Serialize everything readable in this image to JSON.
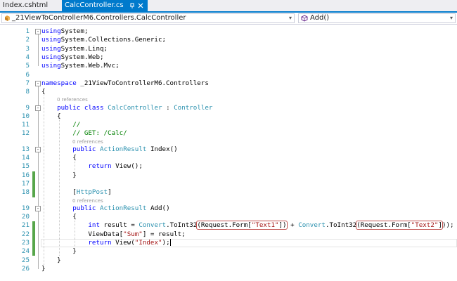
{
  "tabs": [
    {
      "label": "Index.cshtml",
      "active": false
    },
    {
      "label": "CalcController.cs",
      "active": true,
      "pin_icon": "pin-icon",
      "close_icon": "close-icon"
    }
  ],
  "navbar": {
    "type_selector": "_21ViewToControllerM6.Controllers.CalcController",
    "member_selector": "Add()",
    "type_icon": "class-icon",
    "member_icon": "method-icon"
  },
  "codelens": "0 references",
  "colors": {
    "keyword": "#0000ff",
    "type": "#2b91af",
    "comment": "#008000",
    "string": "#a31515",
    "line_number": "#2b91af",
    "accent": "#007acc",
    "highlight_box": "#c0504d",
    "change_bar": "#57a64a"
  },
  "lines": [
    {
      "n": "1",
      "tokens": [
        [
          "kw",
          "using"
        ],
        [
          "",
          "System;"
        ]
      ]
    },
    {
      "n": "2",
      "tokens": [
        [
          "kw",
          "using"
        ],
        [
          "",
          "System.Collections.Generic;"
        ]
      ]
    },
    {
      "n": "3",
      "tokens": [
        [
          "kw",
          "using"
        ],
        [
          "",
          "System.Linq;"
        ]
      ]
    },
    {
      "n": "4",
      "tokens": [
        [
          "kw",
          "using"
        ],
        [
          "",
          "System.Web;"
        ]
      ]
    },
    {
      "n": "5",
      "tokens": [
        [
          "kw",
          "using"
        ],
        [
          "",
          "System.Web.Mvc;"
        ]
      ]
    },
    {
      "n": "6",
      "tokens": []
    },
    {
      "n": "7",
      "tokens": [
        [
          "kw",
          "namespace"
        ],
        [
          "",
          " _21ViewToControllerM6.Controllers"
        ]
      ]
    },
    {
      "n": "8",
      "tokens": [
        [
          "",
          "{"
        ]
      ]
    },
    {
      "n": "9",
      "lens": true,
      "tokens": [
        [
          "",
          "    "
        ],
        [
          "kw",
          "public class"
        ],
        [
          "",
          " "
        ],
        [
          "ty",
          "CalcController"
        ],
        [
          "",
          " : "
        ],
        [
          "ty",
          "Controller"
        ]
      ]
    },
    {
      "n": "10",
      "tokens": [
        [
          "",
          "    {"
        ]
      ]
    },
    {
      "n": "11",
      "tokens": [
        [
          "",
          "        "
        ],
        [
          "cm",
          "//"
        ]
      ]
    },
    {
      "n": "12",
      "tokens": [
        [
          "",
          "        "
        ],
        [
          "cm",
          "// GET: /Calc/"
        ]
      ]
    },
    {
      "n": "13",
      "lens": true,
      "tokens": [
        [
          "",
          "        "
        ],
        [
          "kw",
          "public"
        ],
        [
          "",
          " "
        ],
        [
          "ty",
          "ActionResult"
        ],
        [
          "",
          " Index()"
        ]
      ]
    },
    {
      "n": "14",
      "tokens": [
        [
          "",
          "        {"
        ]
      ]
    },
    {
      "n": "15",
      "tokens": [
        [
          "",
          "            "
        ],
        [
          "kw",
          "return"
        ],
        [
          "",
          " View();"
        ]
      ]
    },
    {
      "n": "16",
      "tokens": [
        [
          "",
          "        }"
        ]
      ]
    },
    {
      "n": "17",
      "tokens": []
    },
    {
      "n": "18",
      "tokens": [
        [
          "",
          "        ["
        ],
        [
          "ty",
          "HttpPost"
        ],
        [
          "",
          "]"
        ]
      ]
    },
    {
      "n": "19",
      "lens": true,
      "tokens": [
        [
          "",
          "        "
        ],
        [
          "kw",
          "public"
        ],
        [
          "",
          " "
        ],
        [
          "ty",
          "ActionResult"
        ],
        [
          "",
          " Add()"
        ]
      ]
    },
    {
      "n": "20",
      "tokens": [
        [
          "",
          "        {"
        ]
      ]
    },
    {
      "n": "21",
      "tokens": [
        [
          "",
          "            "
        ],
        [
          "kw",
          "int"
        ],
        [
          "",
          " result = "
        ],
        [
          "ty",
          "Convert"
        ],
        [
          "",
          ".ToInt32"
        ],
        [
          "box",
          "(Request.Form[|\"Text1\"|])"
        ],
        [
          "",
          " + "
        ],
        [
          "ty",
          "Convert"
        ],
        [
          "",
          ".ToInt32"
        ],
        [
          "box",
          "(Request.Form[|\"Text2\"|]"
        ],
        [
          "",
          "));"
        ]
      ]
    },
    {
      "n": "22",
      "tokens": [
        [
          "",
          "            ViewData["
        ],
        [
          "st",
          "\"Sum\""
        ],
        [
          "",
          "] = result;"
        ]
      ]
    },
    {
      "n": "23",
      "current": true,
      "tokens": [
        [
          "",
          "            "
        ],
        [
          "kw",
          "return"
        ],
        [
          "",
          " View("
        ],
        [
          "st",
          "\"Index\""
        ],
        [
          "",
          ");"
        ],
        [
          "caret",
          ""
        ]
      ]
    },
    {
      "n": "24",
      "tokens": [
        [
          "",
          "        }"
        ]
      ]
    },
    {
      "n": "25",
      "tokens": [
        [
          "",
          "    }"
        ]
      ]
    },
    {
      "n": "26",
      "tokens": [
        [
          "",
          "}"
        ]
      ]
    }
  ]
}
